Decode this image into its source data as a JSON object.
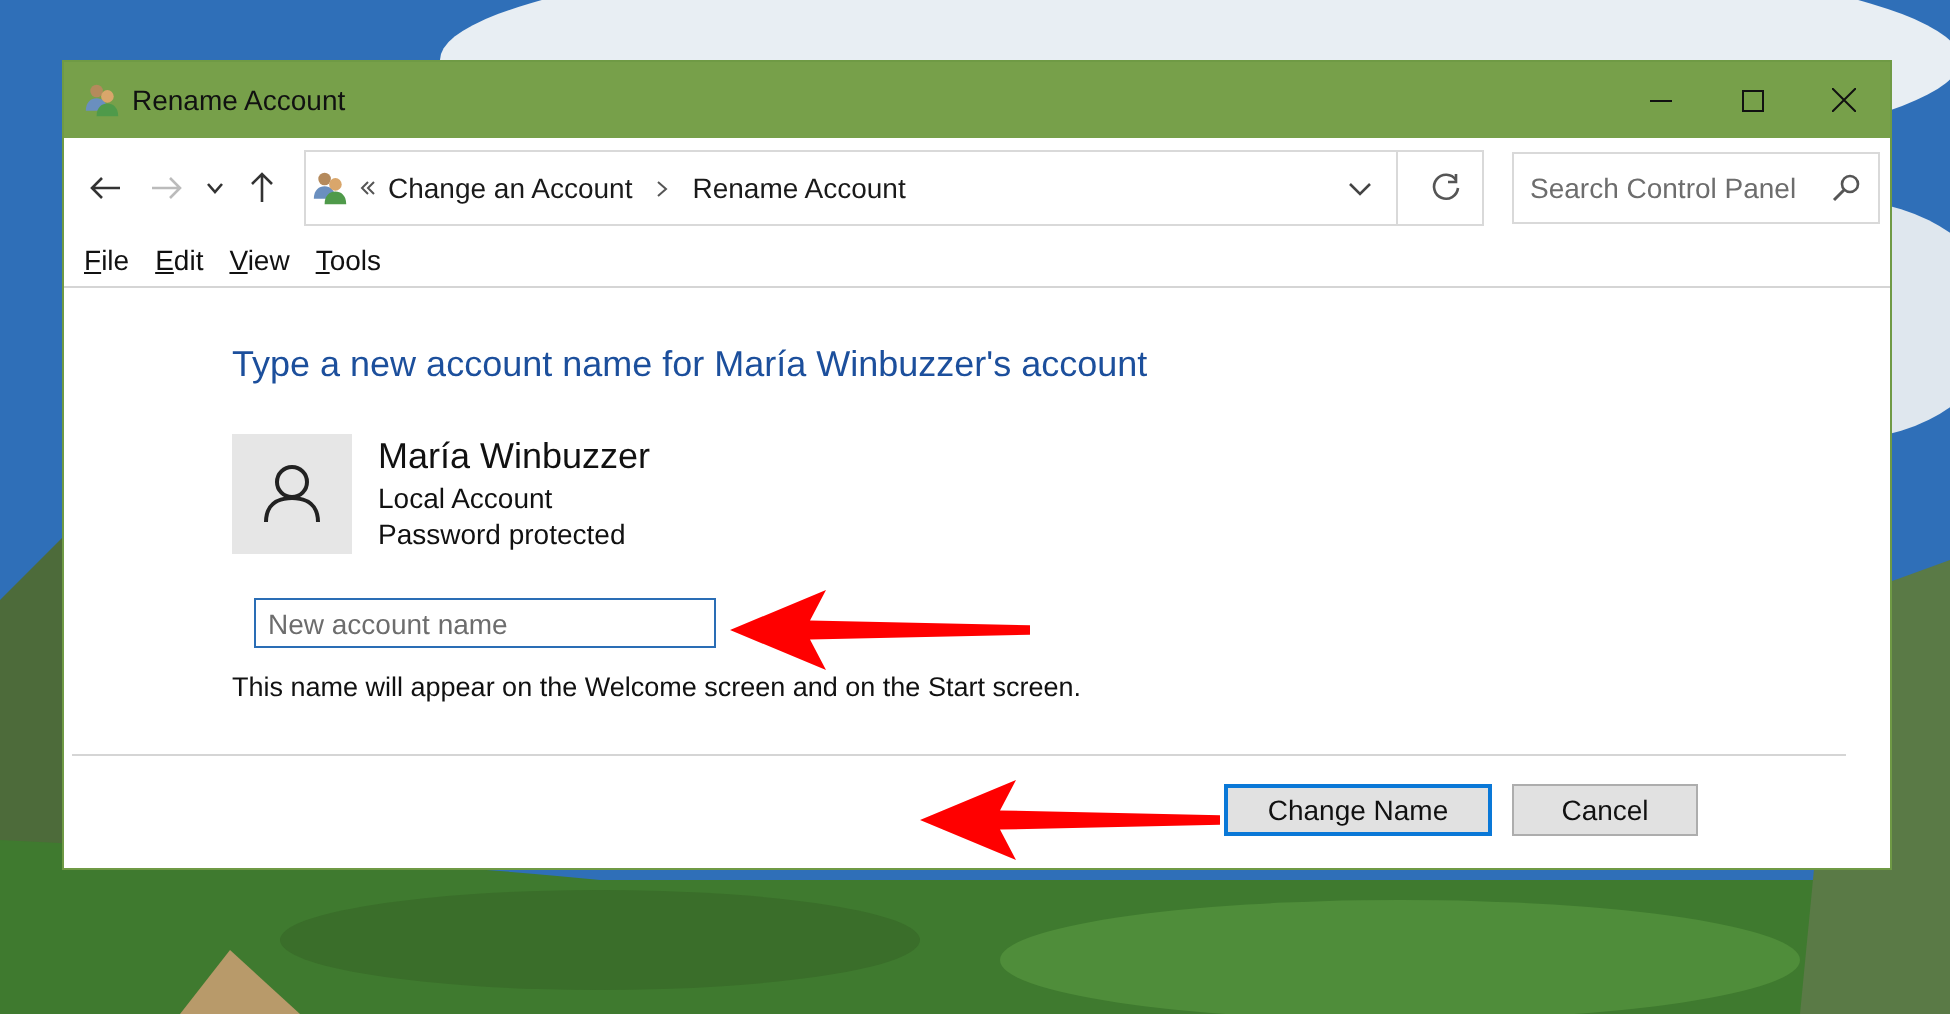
{
  "window": {
    "title": "Rename Account"
  },
  "navigation": {
    "breadcrumb": [
      "Change an Account",
      "Rename Account"
    ],
    "search": {
      "placeholder": "Search Control Panel"
    }
  },
  "menu": [
    "File",
    "Edit",
    "View",
    "Tools"
  ],
  "heading": "Type a new account name for María Winbuzzer's account",
  "account": {
    "name": "María Winbuzzer",
    "type": "Local Account",
    "status": "Password protected"
  },
  "new_name_field": {
    "placeholder": "New account name"
  },
  "note": "This name will appear on the Welcome screen and on the Start screen.",
  "buttons": [
    {
      "label": "Change Name",
      "default": true
    },
    {
      "label": "Cancel",
      "default": false
    }
  ]
}
